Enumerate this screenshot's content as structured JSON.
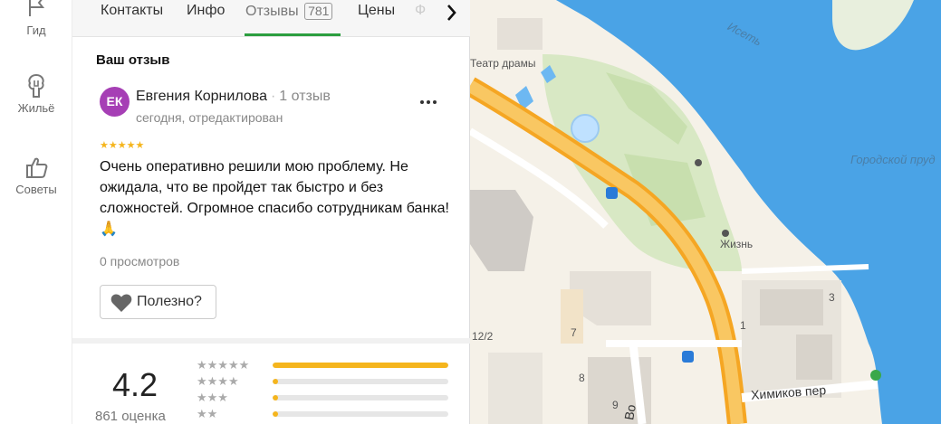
{
  "rail": {
    "items": [
      {
        "label": "Гид",
        "icon": "flag-icon"
      },
      {
        "label": "Жильё",
        "icon": "house-icon"
      },
      {
        "label": "Советы",
        "icon": "thumbs-up-icon"
      }
    ]
  },
  "tabs": {
    "contacts": "Контакты",
    "info": "Инфо",
    "reviews": "Отзывы",
    "reviews_count": "781",
    "prices": "Цены",
    "next_partial": "Ф"
  },
  "review": {
    "section_title": "Ваш отзыв",
    "avatar_initials": "ЕК",
    "author": "Евгения Корнилова",
    "author_reviews": "1 отзыв",
    "date": "сегодня, отредактирован",
    "stars": "★★★★★",
    "rating": 5,
    "text": "Очень оперативно решили мою проблему. Не ожидала, что ве пройдет так быстро и без сложностей. Огромное спасибо сотрудникам банка! 🙏",
    "views": "0 просмотров",
    "helpful_label": "Полезно?"
  },
  "summary": {
    "rating": "4.2",
    "count": "861 оценка",
    "distribution": [
      {
        "stars": "★★★★★",
        "fraction": 1.0
      },
      {
        "stars": "★★★★",
        "fraction": 0.03
      },
      {
        "stars": "★★★",
        "fraction": 0.03
      },
      {
        "stars": "★★",
        "fraction": 0.03
      }
    ]
  },
  "map": {
    "labels": {
      "theater": "Театр драмы",
      "river": "Исеть",
      "pond": "Городской пруд",
      "life": "Жизнь",
      "street_himikov": "Химиков пер",
      "street_vo": "Во",
      "num_1": "1",
      "num_3": "3",
      "num_7": "7",
      "num_8": "8",
      "num_9": "9",
      "num_12_2": "12/2"
    }
  },
  "colors": {
    "accent_green": "#2c9e3f",
    "star": "#f5b51d",
    "avatar": "#a63fb5",
    "water": "#4a9fe0",
    "road": "#f7b731"
  }
}
